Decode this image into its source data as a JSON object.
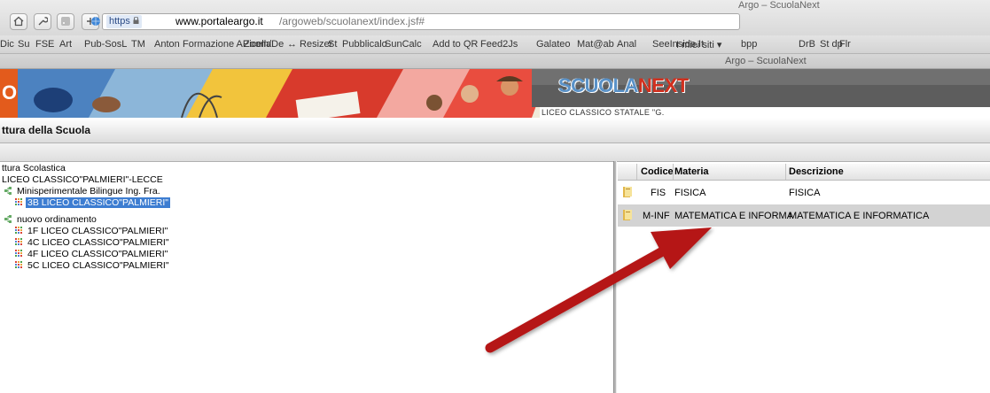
{
  "browser": {
    "window_title": "Argo – ScuolaNext",
    "tab_title": "Argo – ScuolaNext",
    "url_https": "https",
    "url_domain": "www.portaleargo.it",
    "url_path": "/argoweb/scuolanext/index.jsf#",
    "bookmarks": [
      "Dic",
      "Su",
      "FSE",
      "Art",
      "Pub-SosL",
      "TM",
      "Anton",
      "Formazione APicella",
      "Zoom/De",
      "↔ Resizer",
      "St",
      "Pubblicalo",
      "SunCalc",
      "Add to QR",
      "Feed2Js",
      "Galateo",
      "Mat@ab",
      "Anal",
      "SeeInside.It",
      "I miei siti ▾",
      "bpp",
      "DrB",
      "St dp",
      "Flr"
    ]
  },
  "banner": {
    "logo_left": "SCUOLA",
    "logo_right": "NEXT",
    "school": "LICEO CLASSICO STATALE \"G.",
    "corner_letter": "O"
  },
  "page": {
    "title": "ttura della Scuola"
  },
  "tree": [
    {
      "label": "ttura Scolastica",
      "icon": "none"
    },
    {
      "label": "LICEO CLASSICO\"PALMIERI\"-LECCE",
      "icon": "none"
    },
    {
      "label": "Minisperimentale Bilingue Ing. Fra.",
      "icon": "branch-icon"
    },
    {
      "label": "3B LICEO CLASSICO\"PALMIERI\"",
      "icon": "class-icon",
      "selected": true
    },
    {
      "label": "nuovo ordinamento",
      "icon": "branch-icon"
    },
    {
      "label": "1F LICEO CLASSICO\"PALMIERI\"",
      "icon": "class-icon"
    },
    {
      "label": "4C LICEO CLASSICO\"PALMIERI\"",
      "icon": "class-icon"
    },
    {
      "label": "4F LICEO CLASSICO\"PALMIERI\"",
      "icon": "class-icon"
    },
    {
      "label": "5C LICEO CLASSICO\"PALMIERI\"",
      "icon": "class-icon"
    }
  ],
  "table": {
    "headers": {
      "codice": "Codice",
      "materia": "Materia",
      "descrizione": "Descrizione"
    },
    "rows": [
      {
        "codice": "FIS",
        "materia": "FISICA",
        "descrizione": "FISICA"
      },
      {
        "codice": "M-INF",
        "materia": "MATEMATICA E INFORMA",
        "descrizione": "MATEMATICA E INFORMATICA"
      }
    ]
  },
  "colors": {
    "selection": "#3d7dd1",
    "arrow": "#b51414",
    "selected_row": "#d3d3d3"
  }
}
